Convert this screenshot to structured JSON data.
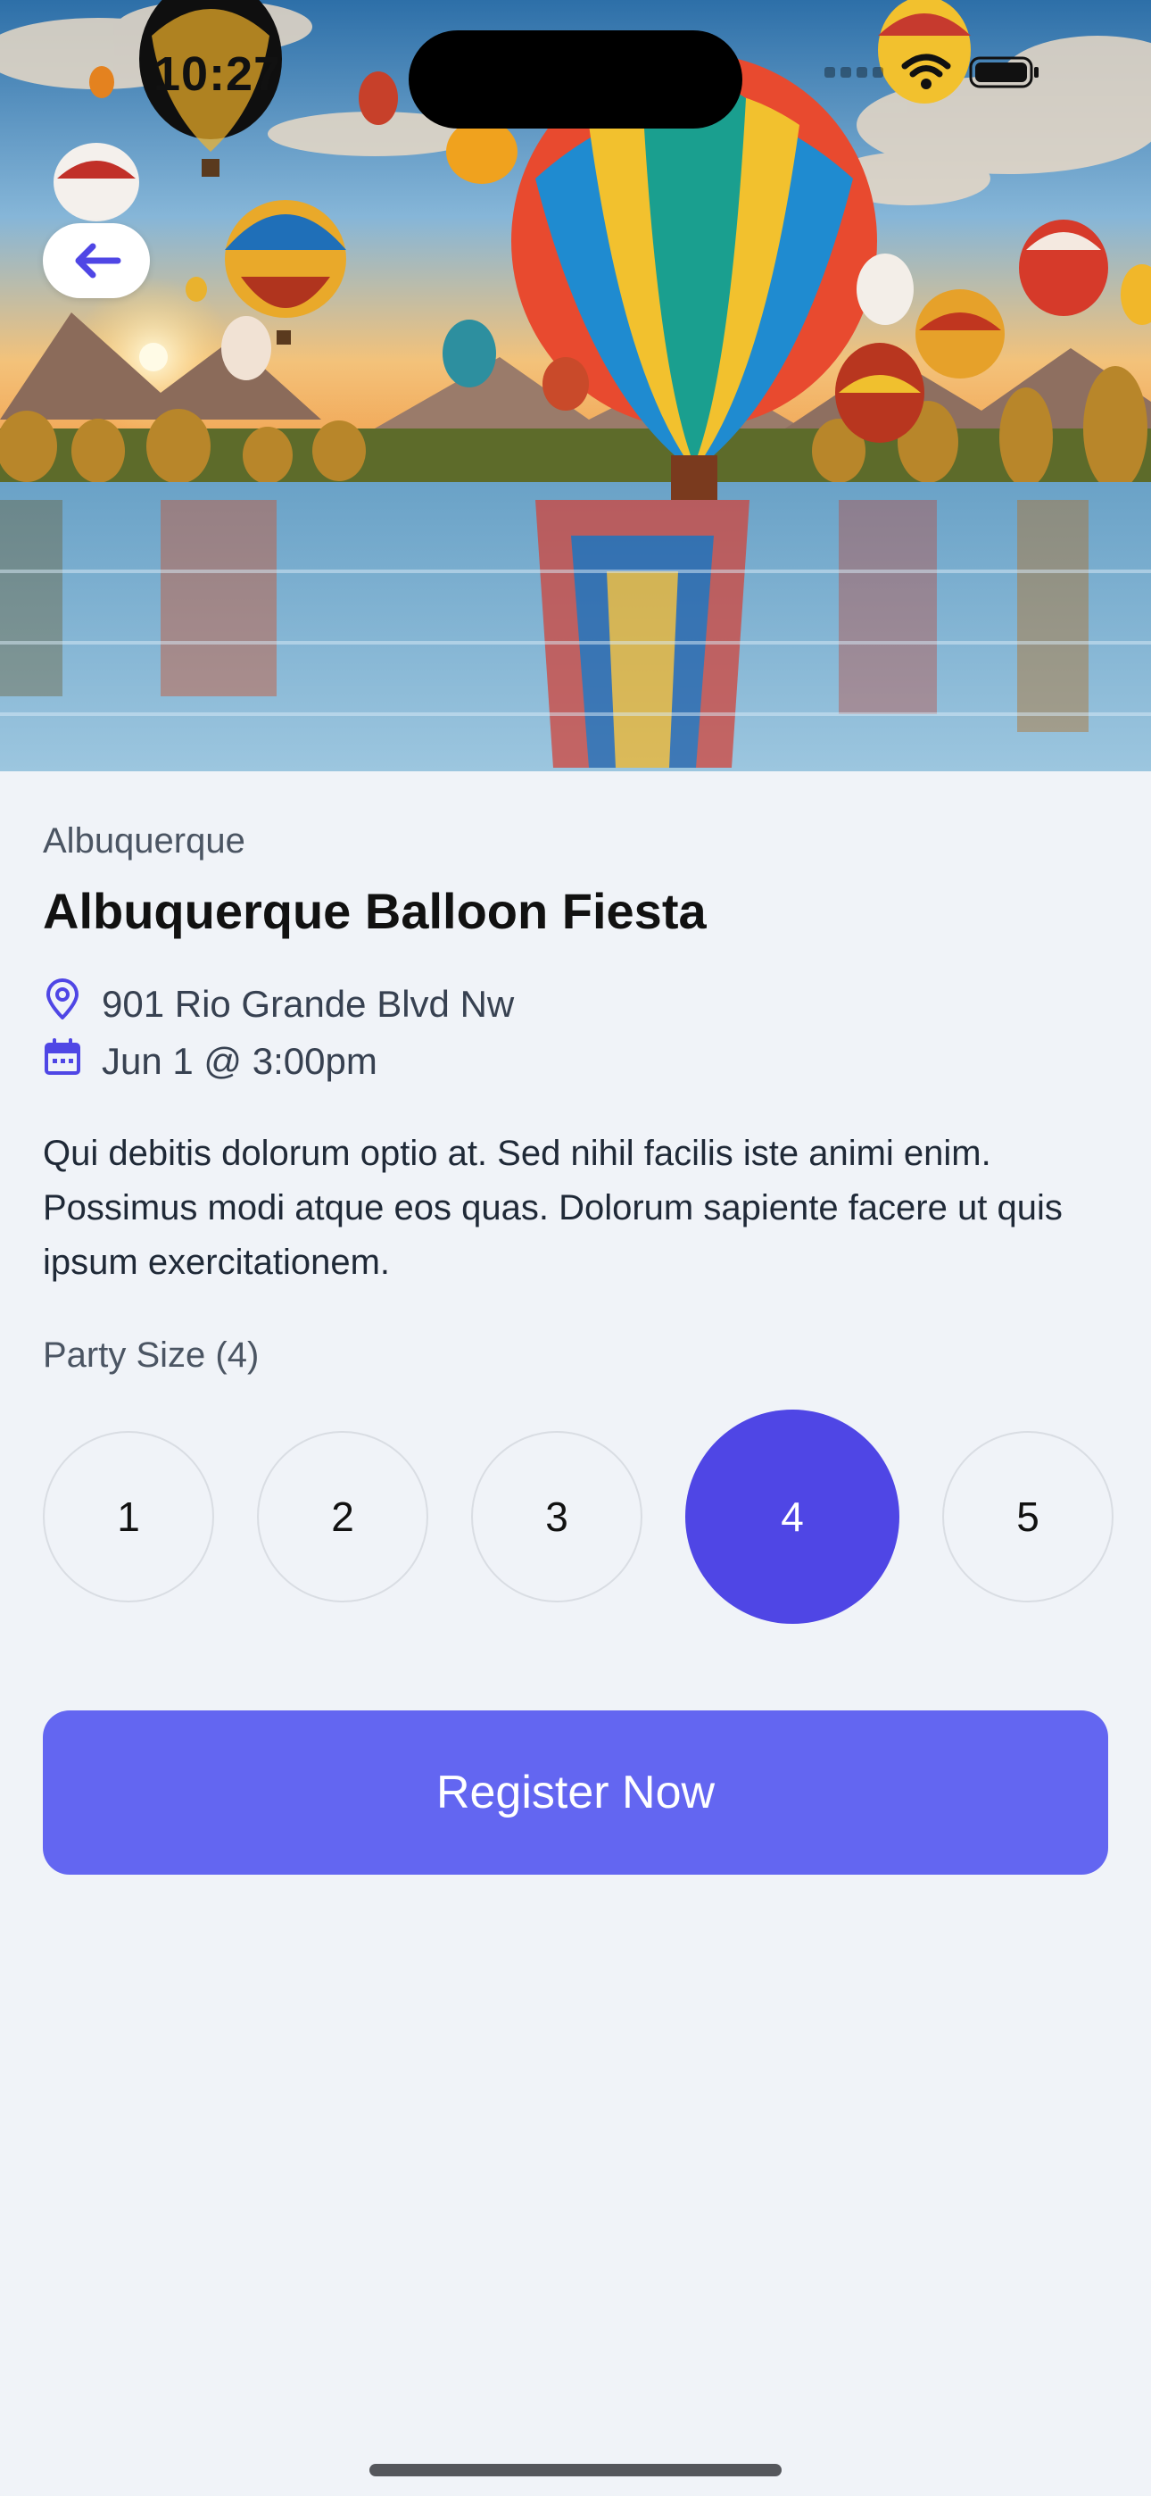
{
  "status_bar": {
    "time": "10:27"
  },
  "hero": {
    "back_icon": "arrow-left-icon"
  },
  "event": {
    "city": "Albuquerque",
    "title": "Albuquerque Balloon Fiesta",
    "address": "901 Rio Grande Blvd Nw",
    "address_icon": "map-pin-icon",
    "date": "Jun 1 @ 3:00pm",
    "date_icon": "calendar-icon",
    "description": "Qui debitis dolorum optio at. Sed nihil facilis iste animi enim. Possimus modi atque eos quas. Dolorum sapiente facere ut quis ipsum exercitationem."
  },
  "party_size": {
    "label": "Party Size (4)",
    "options": [
      "1",
      "2",
      "3",
      "4",
      "5"
    ],
    "selected": "4"
  },
  "register": {
    "label": "Register Now"
  },
  "colors": {
    "accent": "#4f46e5",
    "button": "#6366f1",
    "background": "#f0f3f8"
  }
}
